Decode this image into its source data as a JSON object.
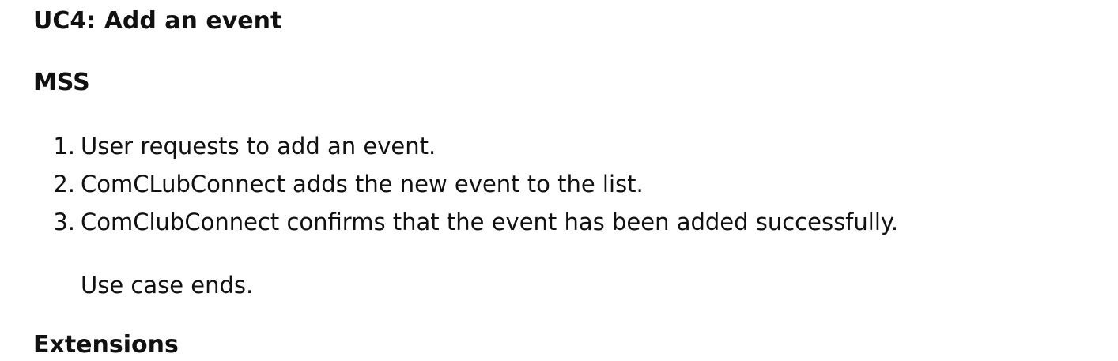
{
  "use_case": {
    "title": "UC4: Add an event",
    "mss_heading": "MSS",
    "steps": [
      {
        "number": "1.",
        "text": "User requests to add an event."
      },
      {
        "number": "2.",
        "text": "ComCLubConnect adds the new event to the list."
      },
      {
        "number": "3.",
        "text": "ComClubConnect confirms that the event has been added successfully."
      }
    ],
    "end_note": "Use case ends.",
    "extensions_heading": "Extensions"
  }
}
